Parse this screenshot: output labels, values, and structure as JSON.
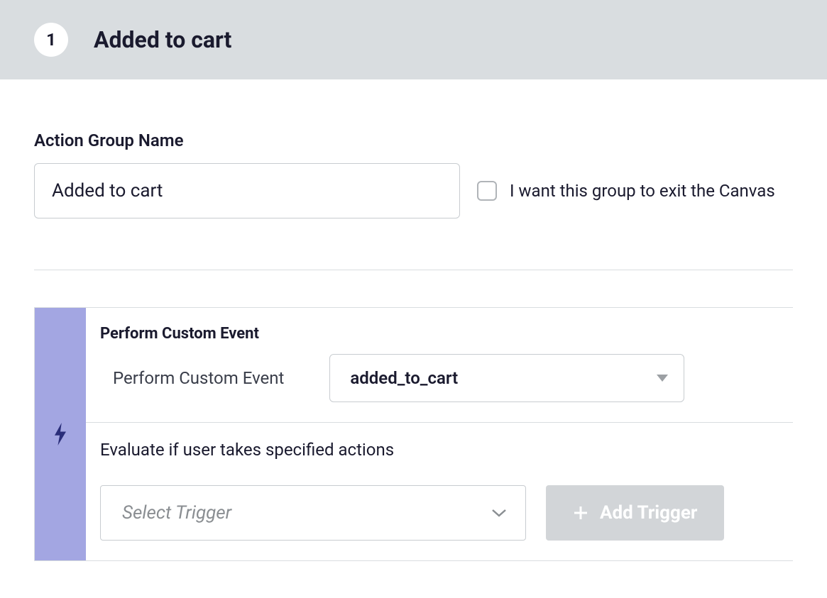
{
  "header": {
    "step_number": "1",
    "title": "Added to cart"
  },
  "form": {
    "group_name_label": "Action Group Name",
    "group_name_value": "Added to cart",
    "exit_canvas_label": "I want this group to exit the Canvas"
  },
  "event": {
    "heading": "Perform Custom Event",
    "sublabel": "Perform Custom Event",
    "selected_event": "added_to_cart",
    "evaluate_heading": "Evaluate if user takes specified actions",
    "trigger_placeholder": "Select Trigger",
    "add_trigger_label": "Add Trigger"
  }
}
